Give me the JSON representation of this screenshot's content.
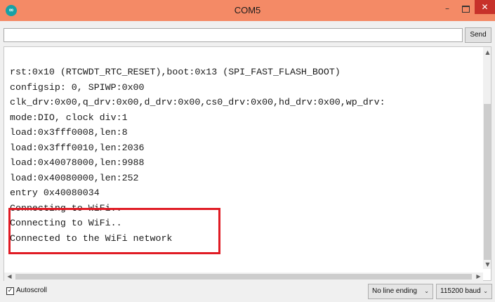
{
  "window": {
    "title": "COM5",
    "logo_text": "∞",
    "minimize_glyph": "–",
    "close_glyph": "✕"
  },
  "input": {
    "value": "",
    "send_label": "Send"
  },
  "console": {
    "lines": [
      "rst:0x10 (RTCWDT_RTC_RESET),boot:0x13 (SPI_FAST_FLASH_BOOT)",
      "configsip: 0, SPIWP:0x00",
      "clk_drv:0x00,q_drv:0x00,d_drv:0x00,cs0_drv:0x00,hd_drv:0x00,wp_drv:",
      "mode:DIO, clock div:1",
      "load:0x3fff0008,len:8",
      "load:0x3fff0010,len:2036",
      "load:0x40078000,len:9988",
      "load:0x40080000,len:252",
      "entry 0x40080034",
      "Connecting to WiFi..",
      "Connecting to WiFi..",
      "Connected to the WiFi network"
    ],
    "highlight_color": "#e01b24"
  },
  "statusbar": {
    "autoscroll_label": "Autoscroll",
    "autoscroll_checked": "✓",
    "line_ending": "No line ending",
    "baud": "115200 baud"
  },
  "icons": {
    "scroll_up": "▲",
    "scroll_down": "▼",
    "scroll_left": "◀",
    "scroll_right": "▶",
    "chevron_down": "⌄"
  },
  "colors": {
    "titlebar": "#f48a66",
    "close": "#c7312a",
    "logo": "#17a1a5"
  }
}
